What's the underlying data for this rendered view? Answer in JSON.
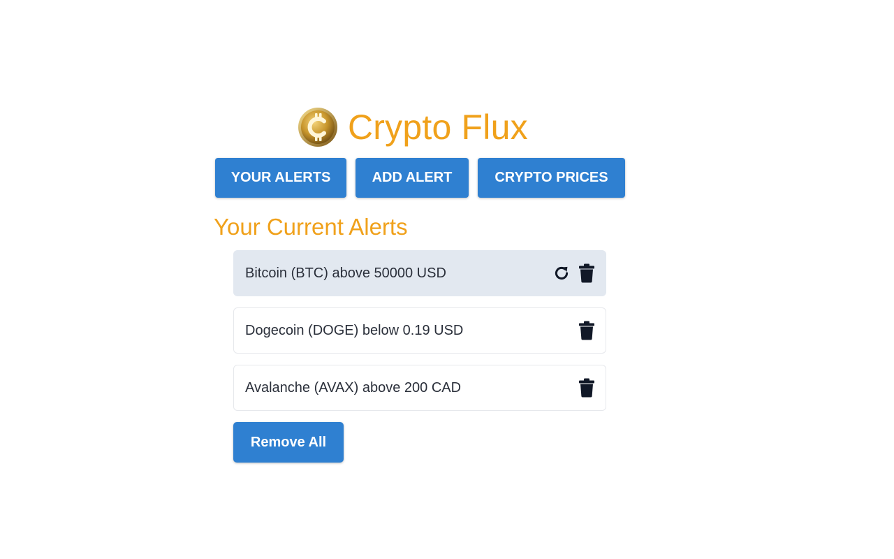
{
  "app": {
    "title": "Crypto Flux",
    "logo_icon": "bitcoin-coin-logo",
    "accent_color": "#f0a11b",
    "primary_color": "#2f80d1"
  },
  "nav": {
    "items": [
      {
        "label": "YOUR ALERTS"
      },
      {
        "label": "ADD ALERT"
      },
      {
        "label": "CRYPTO PRICES"
      }
    ]
  },
  "main": {
    "section_title": "Your Current Alerts",
    "alerts": [
      {
        "text": "Bitcoin (BTC) above 50000 USD",
        "icons": [
          "refresh-icon",
          "trash-icon"
        ],
        "highlighted": true
      },
      {
        "text": "Dogecoin (DOGE) below 0.19 USD",
        "icons": [
          "trash-icon"
        ],
        "highlighted": false
      },
      {
        "text": "Avalanche (AVAX) above 200 CAD",
        "icons": [
          "trash-icon"
        ],
        "highlighted": false
      }
    ],
    "remove_all_label": "Remove All"
  }
}
